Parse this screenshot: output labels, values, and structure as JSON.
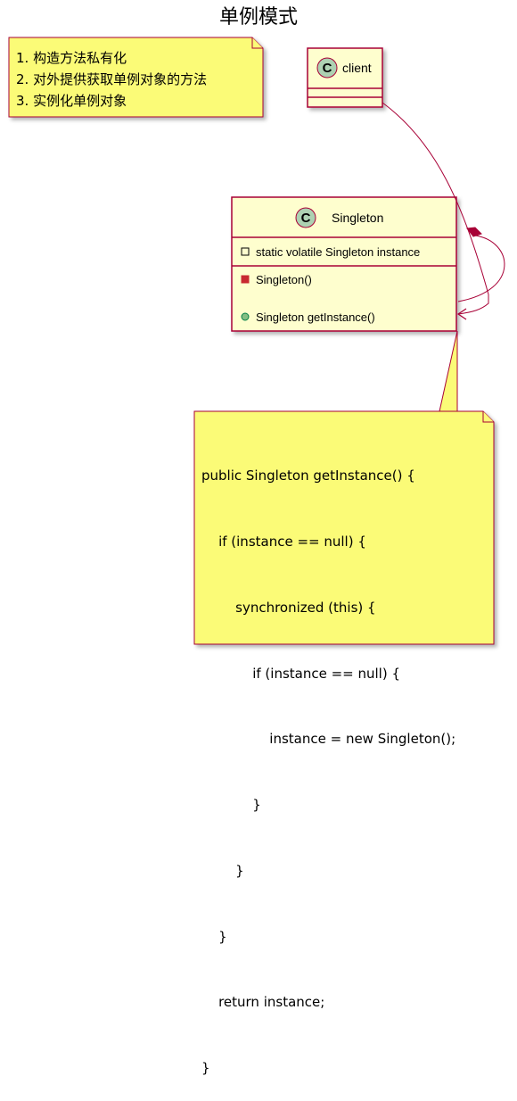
{
  "diagram": {
    "title": "单例模式",
    "top_note": {
      "lines": [
        "1. 构造方法私有化",
        "2. 对外提供获取单例对象的方法",
        "3. 实例化单例对象"
      ]
    },
    "client_class": {
      "stereotype_letter": "C",
      "name": "client"
    },
    "singleton_class": {
      "stereotype_letter": "C",
      "name": "Singleton",
      "field": "static volatile Singleton instance",
      "constructor": "Singleton()",
      "method": "Singleton getInstance()"
    },
    "code_note": {
      "lines": [
        "public Singleton getInstance() {",
        "    if (instance == null) {",
        "        synchronized (this) {",
        "            if (instance == null) {",
        "                instance = new Singleton();",
        "            }",
        "        }",
        "    }",
        "    return instance;",
        "}"
      ]
    },
    "colors": {
      "class_fill": "#FEFECE",
      "note_fill": "#FBFB77",
      "border": "#A80036",
      "circle_fill": "#ADD1B2",
      "private_marker": "#C82930",
      "public_marker": "#84BE84"
    }
  }
}
